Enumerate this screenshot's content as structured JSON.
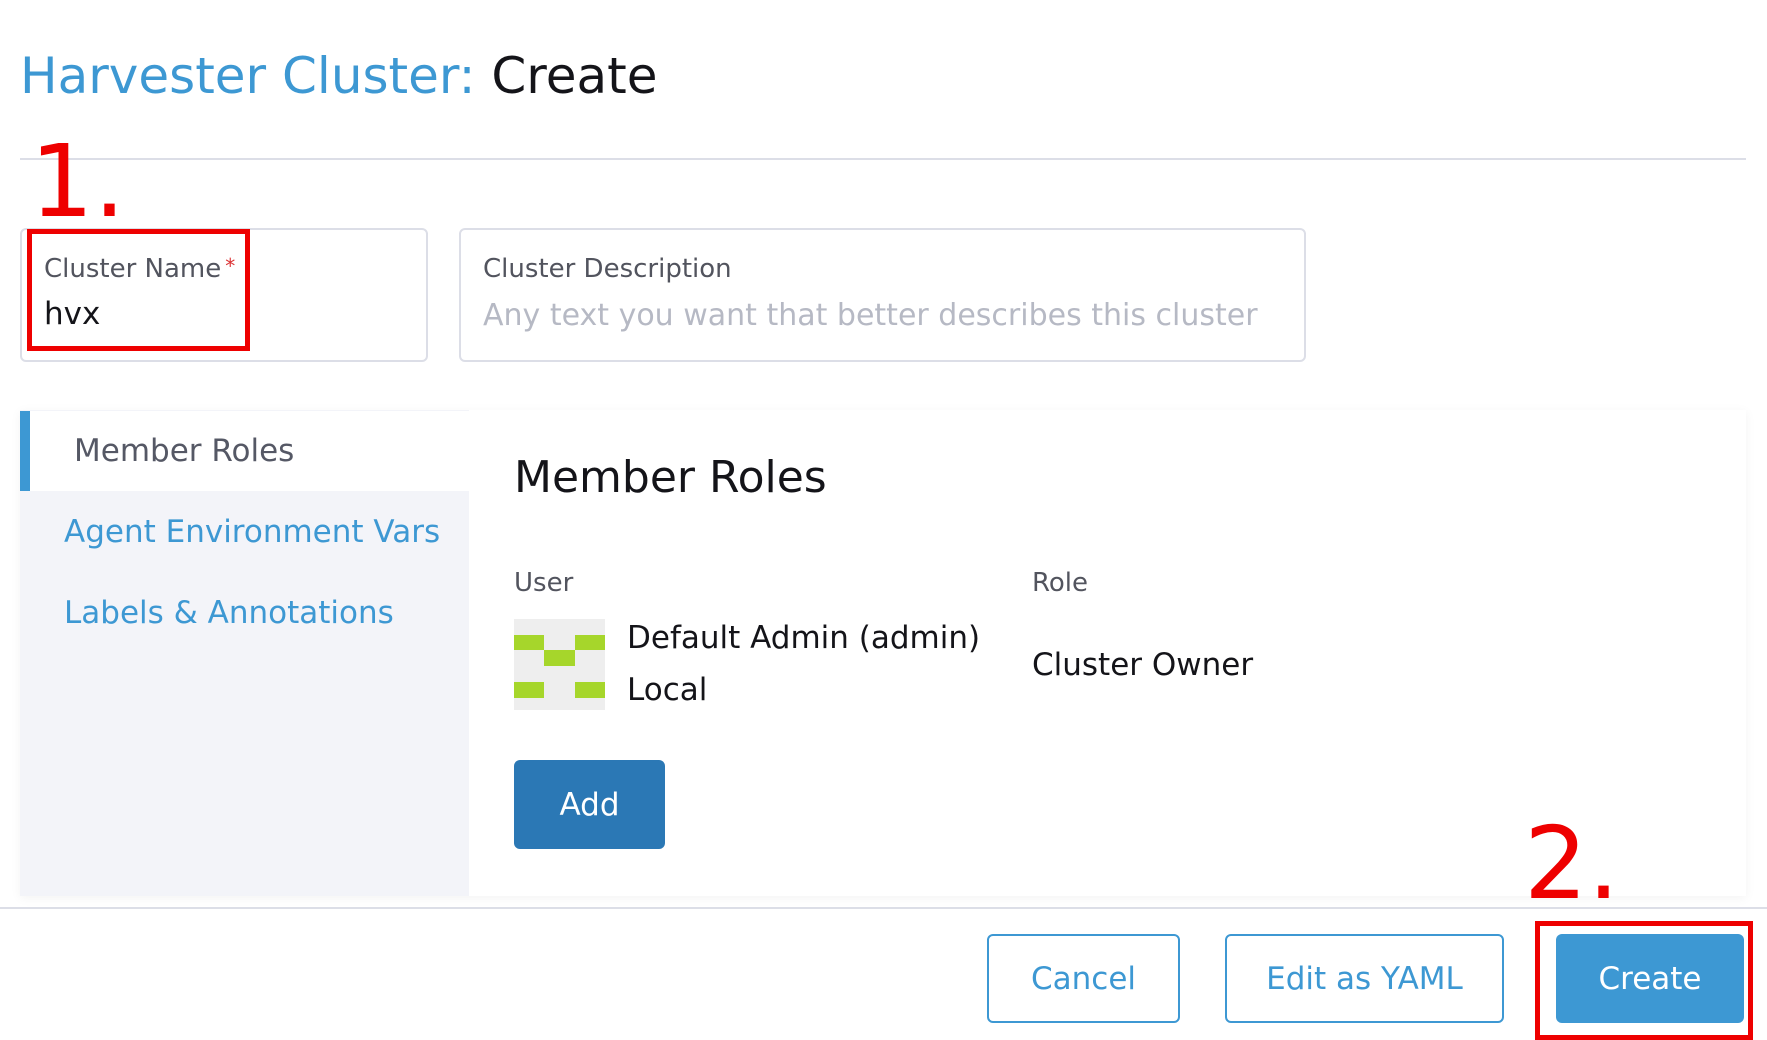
{
  "header": {
    "title_prefix": "Harvester Cluster:",
    "title_action": "Create"
  },
  "form": {
    "cluster_name": {
      "label": "Cluster Name",
      "required_marker": "*",
      "value": "hvx"
    },
    "cluster_description": {
      "label": "Cluster Description",
      "placeholder": "Any text you want that better describes this cluster",
      "value": ""
    }
  },
  "tabs": [
    {
      "label": "Member Roles",
      "active": true
    },
    {
      "label": "Agent Environment Vars",
      "active": false
    },
    {
      "label": "Labels & Annotations",
      "active": false
    }
  ],
  "member_roles": {
    "section_title": "Member Roles",
    "columns": {
      "user": "User",
      "role": "Role"
    },
    "members": [
      {
        "display_name": "Default Admin (admin)",
        "provider": "Local",
        "role": "Cluster Owner",
        "avatar_icon": "identicon-avatar"
      }
    ],
    "add_label": "Add"
  },
  "footer": {
    "cancel_label": "Cancel",
    "yaml_label": "Edit as YAML",
    "create_label": "Create"
  },
  "annotations": {
    "step1": "1.",
    "step2": "2.",
    "color": "#ee0000"
  },
  "colors": {
    "primary": "#3d98d3",
    "primary_dark": "#2b78b5",
    "avatar_green": "#a6d62b",
    "required": "#db3234"
  }
}
